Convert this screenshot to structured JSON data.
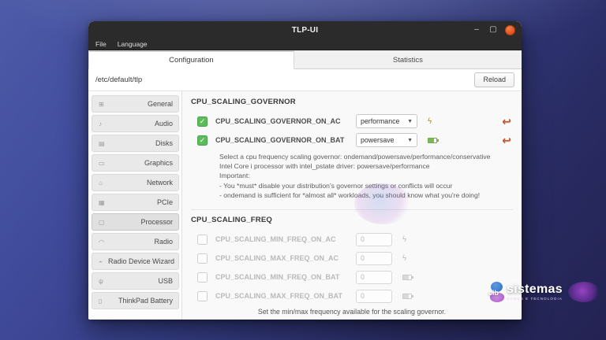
{
  "window": {
    "title": "TLP-UI",
    "controls": {
      "minimize": "–",
      "maximize": "▢"
    },
    "menu": {
      "items": [
        {
          "label": "File"
        },
        {
          "label": "Language"
        }
      ]
    },
    "tabs": [
      {
        "label": "Configuration",
        "active": true
      },
      {
        "label": "Statistics",
        "active": false
      }
    ],
    "path": "/etc/default/tlp",
    "reload_label": "Reload"
  },
  "sidebar": {
    "items": [
      {
        "label": "General",
        "icon": "⊞"
      },
      {
        "label": "Audio",
        "icon": "♪"
      },
      {
        "label": "Disks",
        "icon": "▤"
      },
      {
        "label": "Graphics",
        "icon": "▭"
      },
      {
        "label": "Network",
        "icon": "⌂"
      },
      {
        "label": "PCIe",
        "icon": "▦"
      },
      {
        "label": "Processor",
        "icon": "▢"
      },
      {
        "label": "Radio",
        "icon": "◠"
      },
      {
        "label": "Radio Device Wizard",
        "icon": "⌁"
      },
      {
        "label": "USB",
        "icon": "ψ"
      },
      {
        "label": "ThinkPad Battery",
        "icon": "▯"
      }
    ]
  },
  "governor": {
    "header": "CPU_SCALING_GOVERNOR",
    "check_glyph": "✓",
    "rows": [
      {
        "label": "CPU_SCALING_GOVERNOR_ON_AC",
        "value": "performance"
      },
      {
        "label": "CPU_SCALING_GOVERNOR_ON_BAT",
        "value": "powersave"
      }
    ],
    "description_lines": {
      "l1": "Select a cpu frequency scaling governor: ondemand/powersave/performance/conservative",
      "l2": "Intel Core i processor with intel_pstate driver: powersave/performance",
      "l3": "Important:",
      "l4": "- You *must* disable your distribution's governor settings or conflicts will occur",
      "l5": "- ondemand is sufficient for *almost all* workloads, you should know what you're doing!"
    }
  },
  "freq": {
    "header": "CPU_SCALING_FREQ",
    "rows": [
      {
        "label": "CPU_SCALING_MIN_FREQ_ON_AC",
        "value": "0"
      },
      {
        "label": "CPU_SCALING_MAX_FREQ_ON_AC",
        "value": "0"
      },
      {
        "label": "CPU_SCALING_MIN_FREQ_ON_BAT",
        "value": "0"
      },
      {
        "label": "CPU_SCALING_MAX_FREQ_ON_BAT",
        "value": "0"
      }
    ],
    "footer": "Set the min/max frequency available for the scaling governor."
  },
  "watermark": {
    "prefix": "cib",
    "brand": "sistemas",
    "tagline": "GAMES E TECNOLOGIA"
  },
  "colors": {
    "close_orange": "#e85420",
    "check_green": "#5cbc5c",
    "battery_green": "#6fae4a",
    "bolt_yellow": "#c0a73e",
    "undo_orange": "#c4572b"
  }
}
